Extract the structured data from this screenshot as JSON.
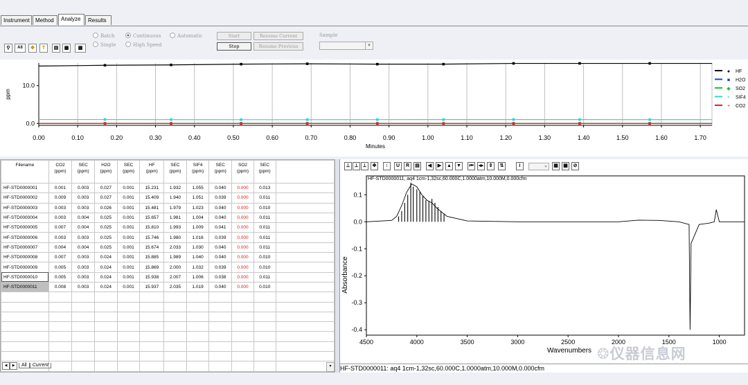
{
  "tabs": [
    "Instrument",
    "Method",
    "Analyze",
    "Results"
  ],
  "toolbar": {
    "tools": [
      "Q",
      "All",
      "zoom",
      "T",
      "print",
      "save",
      "export"
    ],
    "tool_icons": [
      "zoom-icon",
      "zoom-all-icon",
      "move-icon",
      "text-icon",
      "print-icon",
      "save-icon",
      "report-icon"
    ],
    "mode_radios": [
      {
        "label": "Batch",
        "selected": false
      },
      {
        "label": "Continuous",
        "selected": true
      },
      {
        "label": "Automatic",
        "selected": false
      },
      {
        "label": "Single",
        "selected": false
      },
      {
        "label": "High Speed",
        "selected": false
      }
    ],
    "start_label": "Start",
    "stop_label": "Stop",
    "resume_current_label": "Resume Current",
    "resume_previous_label": "Resume Previous",
    "sample_label": "Sample",
    "sample_value": ""
  },
  "trend_chart": {
    "ylabel": "ppm",
    "xlabel": "Minutes",
    "y_ticks": [
      "10.0",
      "0.0"
    ],
    "x_ticks": [
      "0.00",
      "0.10",
      "0.20",
      "0.30",
      "0.40",
      "0.50",
      "0.60",
      "0.70",
      "0.80",
      "0.90",
      "1.00",
      "1.10",
      "1.20",
      "1.30",
      "1.40",
      "1.50",
      "1.60",
      "1.70"
    ],
    "legend": [
      {
        "name": "HF",
        "color": "#000000",
        "marker": "●"
      },
      {
        "name": "H2O",
        "color": "#1c3fe0",
        "marker": "■"
      },
      {
        "name": "SO2",
        "color": "#17c23a",
        "marker": "◆"
      },
      {
        "name": "SIF4",
        "color": "#28d8d8",
        "marker": "×"
      },
      {
        "name": "CO2",
        "color": "#e82020",
        "marker": "+"
      }
    ]
  },
  "chart_data": [
    {
      "type": "line",
      "xlabel": "Minutes",
      "ylabel": "ppm",
      "xlim": [
        0,
        1.73
      ],
      "ylim": [
        -0.5,
        16
      ],
      "x": [
        0.0,
        0.17,
        0.34,
        0.52,
        0.69,
        0.87,
        1.04,
        1.22,
        1.39,
        1.57,
        1.73
      ],
      "series": [
        {
          "name": "HF",
          "values": [
            15.2,
            15.4,
            15.5,
            15.7,
            15.8,
            15.7,
            15.7,
            15.9,
            15.9,
            15.9,
            15.9
          ]
        },
        {
          "name": "H2O",
          "values": [
            0.03,
            0.03,
            0.03,
            0.03,
            0.03,
            0.03,
            0.02,
            0.02,
            0.02,
            0.02,
            0.02
          ]
        },
        {
          "name": "SO2",
          "values": [
            0.0,
            0.0,
            0.0,
            0.0,
            0.0,
            0.0,
            0.0,
            0.0,
            0.0,
            0.0,
            0.0
          ]
        },
        {
          "name": "SIF4",
          "values": [
            1.05,
            1.05,
            1.02,
            1.0,
            1.0,
            1.02,
            1.03,
            1.04,
            1.03,
            1.01,
            1.02
          ]
        },
        {
          "name": "CO2",
          "values": [
            0.001,
            0.009,
            0.003,
            0.003,
            0.007,
            0.003,
            0.004,
            0.007,
            0.005,
            0.005,
            0.008
          ]
        }
      ],
      "legend": "right"
    },
    {
      "type": "line",
      "title": "HF-STD0000011, aq4 1cm-1,32sc,60.000C,1.0000atm,10.000M,0.000cfm",
      "xlabel": "Wavenumbers",
      "ylabel": "Absorbance",
      "xlim": [
        4500,
        750
      ],
      "ylim": [
        -0.42,
        0.17
      ],
      "x_ticks": [
        4500,
        4000,
        3500,
        3000,
        2500,
        2000,
        1500,
        1000
      ],
      "y_ticks": [
        0.1,
        0.0,
        -0.1,
        -0.2,
        -0.3,
        -0.4
      ],
      "x": [
        4500,
        4250,
        4200,
        4150,
        4100,
        4050,
        4000,
        3950,
        3900,
        3850,
        3800,
        3700,
        3500,
        3000,
        2500,
        2000,
        1800,
        1600,
        1400,
        1300,
        1290,
        1280,
        1200,
        1100,
        1050,
        1030,
        1000,
        900,
        750
      ],
      "series": [
        {
          "name": "",
          "values": [
            0.0,
            0.005,
            0.02,
            0.06,
            0.11,
            0.14,
            0.13,
            0.1,
            0.08,
            0.07,
            0.05,
            0.02,
            0.003,
            0.0,
            0.0,
            0.0,
            0.006,
            0.005,
            0.0,
            -0.01,
            -0.4,
            -0.08,
            -0.01,
            -0.005,
            0.0,
            0.045,
            0.0,
            0.0,
            0.0
          ]
        }
      ]
    }
  ],
  "results_table": {
    "headers": [
      [
        "Filename",
        ""
      ],
      [
        "CO2",
        "(ppm)"
      ],
      [
        "SEC",
        "(ppm)"
      ],
      [
        "H2O",
        "(ppm)"
      ],
      [
        "SEC",
        "(ppm)"
      ],
      [
        "HF",
        "(ppm)"
      ],
      [
        "SEC",
        "(ppm)"
      ],
      [
        "SIF4",
        "(ppm)"
      ],
      [
        "SEC",
        "(ppm)"
      ],
      [
        "SO2",
        "(ppm)"
      ],
      [
        "SEC",
        "(ppm)"
      ]
    ],
    "rows": [
      [
        "HF-STD0000001",
        "0.001",
        "0.003",
        "0.027",
        "0.001",
        "15.231",
        "1.932",
        "1.055",
        "0.040",
        "0.000",
        "0.013"
      ],
      [
        "HF-STD0000002",
        "0.009",
        "0.003",
        "0.027",
        "0.001",
        "15.409",
        "1.940",
        "1.051",
        "0.039",
        "0.000",
        "0.011"
      ],
      [
        "HF-STD0000003",
        "0.003",
        "0.003",
        "0.026",
        "0.001",
        "15.481",
        "1.979",
        "1.023",
        "0.040",
        "0.000",
        "0.010"
      ],
      [
        "HF-STD0000004",
        "0.003",
        "0.004",
        "0.025",
        "0.001",
        "15.657",
        "1.981",
        "1.004",
        "0.040",
        "0.000",
        "0.011"
      ],
      [
        "HF-STD0000005",
        "0.007",
        "0.004",
        "0.025",
        "0.001",
        "15.810",
        "1.993",
        "1.009",
        "0.041",
        "0.000",
        "0.011"
      ],
      [
        "HF-STD0000006",
        "0.003",
        "0.003",
        "0.025",
        "0.001",
        "15.746",
        "1.980",
        "1.016",
        "0.039",
        "0.000",
        "0.011"
      ],
      [
        "HF-STD0000007",
        "0.004",
        "0.004",
        "0.025",
        "0.001",
        "15.674",
        "2.033",
        "1.030",
        "0.040",
        "0.000",
        "0.011"
      ],
      [
        "HF-STD0000008",
        "0.007",
        "0.003",
        "0.024",
        "0.001",
        "15.885",
        "1.989",
        "1.040",
        "0.040",
        "0.000",
        "0.010"
      ],
      [
        "HF-STD0000009",
        "0.005",
        "0.003",
        "0.024",
        "0.001",
        "15.869",
        "2.000",
        "1.032",
        "0.039",
        "0.000",
        "0.010"
      ],
      [
        "HF-STD0000010",
        "0.005",
        "0.003",
        "0.024",
        "0.001",
        "15.938",
        "2.007",
        "1.006",
        "0.038",
        "0.000",
        "0.011"
      ],
      [
        "HF-STD0000011",
        "0.008",
        "0.003",
        "0.024",
        "0.001",
        "15.937",
        "2.035",
        "1.019",
        "0.040",
        "0.000",
        "0.010"
      ]
    ],
    "selected_row": 10,
    "current_row": 9,
    "sheet_tabs": [
      "All",
      "Current"
    ]
  },
  "spectrum_toolbar": {
    "icons": [
      "cursor-icon",
      "peak-icon",
      "baseline-icon",
      "move-icon",
      "expand-icon",
      "undo-icon",
      "redo-icon",
      "print-icon",
      "prev-icon",
      "next-icon",
      "up-icon",
      "down-icon",
      "first-icon",
      "expand-h-icon",
      "shrink-h-icon",
      "expand-v-icon",
      "info-icon",
      "grid-icon",
      "stack-icon",
      "overlay-icon"
    ],
    "labels": [
      "U",
      "R",
      "i"
    ]
  },
  "spectrum": {
    "header": "HF-STD0000011, aq4 1cm-1,32sc,60.000C,1.0000atm,10.000M,0.000cfm",
    "status": "HF-STD0000011: aq4 1cm-1,32sc,60.000C,1.0000atm,10.000M,0.000cfm",
    "ylabel": "Absorbance",
    "xlabel": "Wavenumbers",
    "y_ticks": [
      "0.1",
      "0.0",
      "-0.1",
      "-0.2",
      "-0.3",
      "-0.4"
    ],
    "x_ticks": [
      "4500",
      "4000",
      "3500",
      "3000",
      "2500",
      "2000",
      "1500",
      "1000"
    ]
  },
  "watermark": "仪器信息网"
}
